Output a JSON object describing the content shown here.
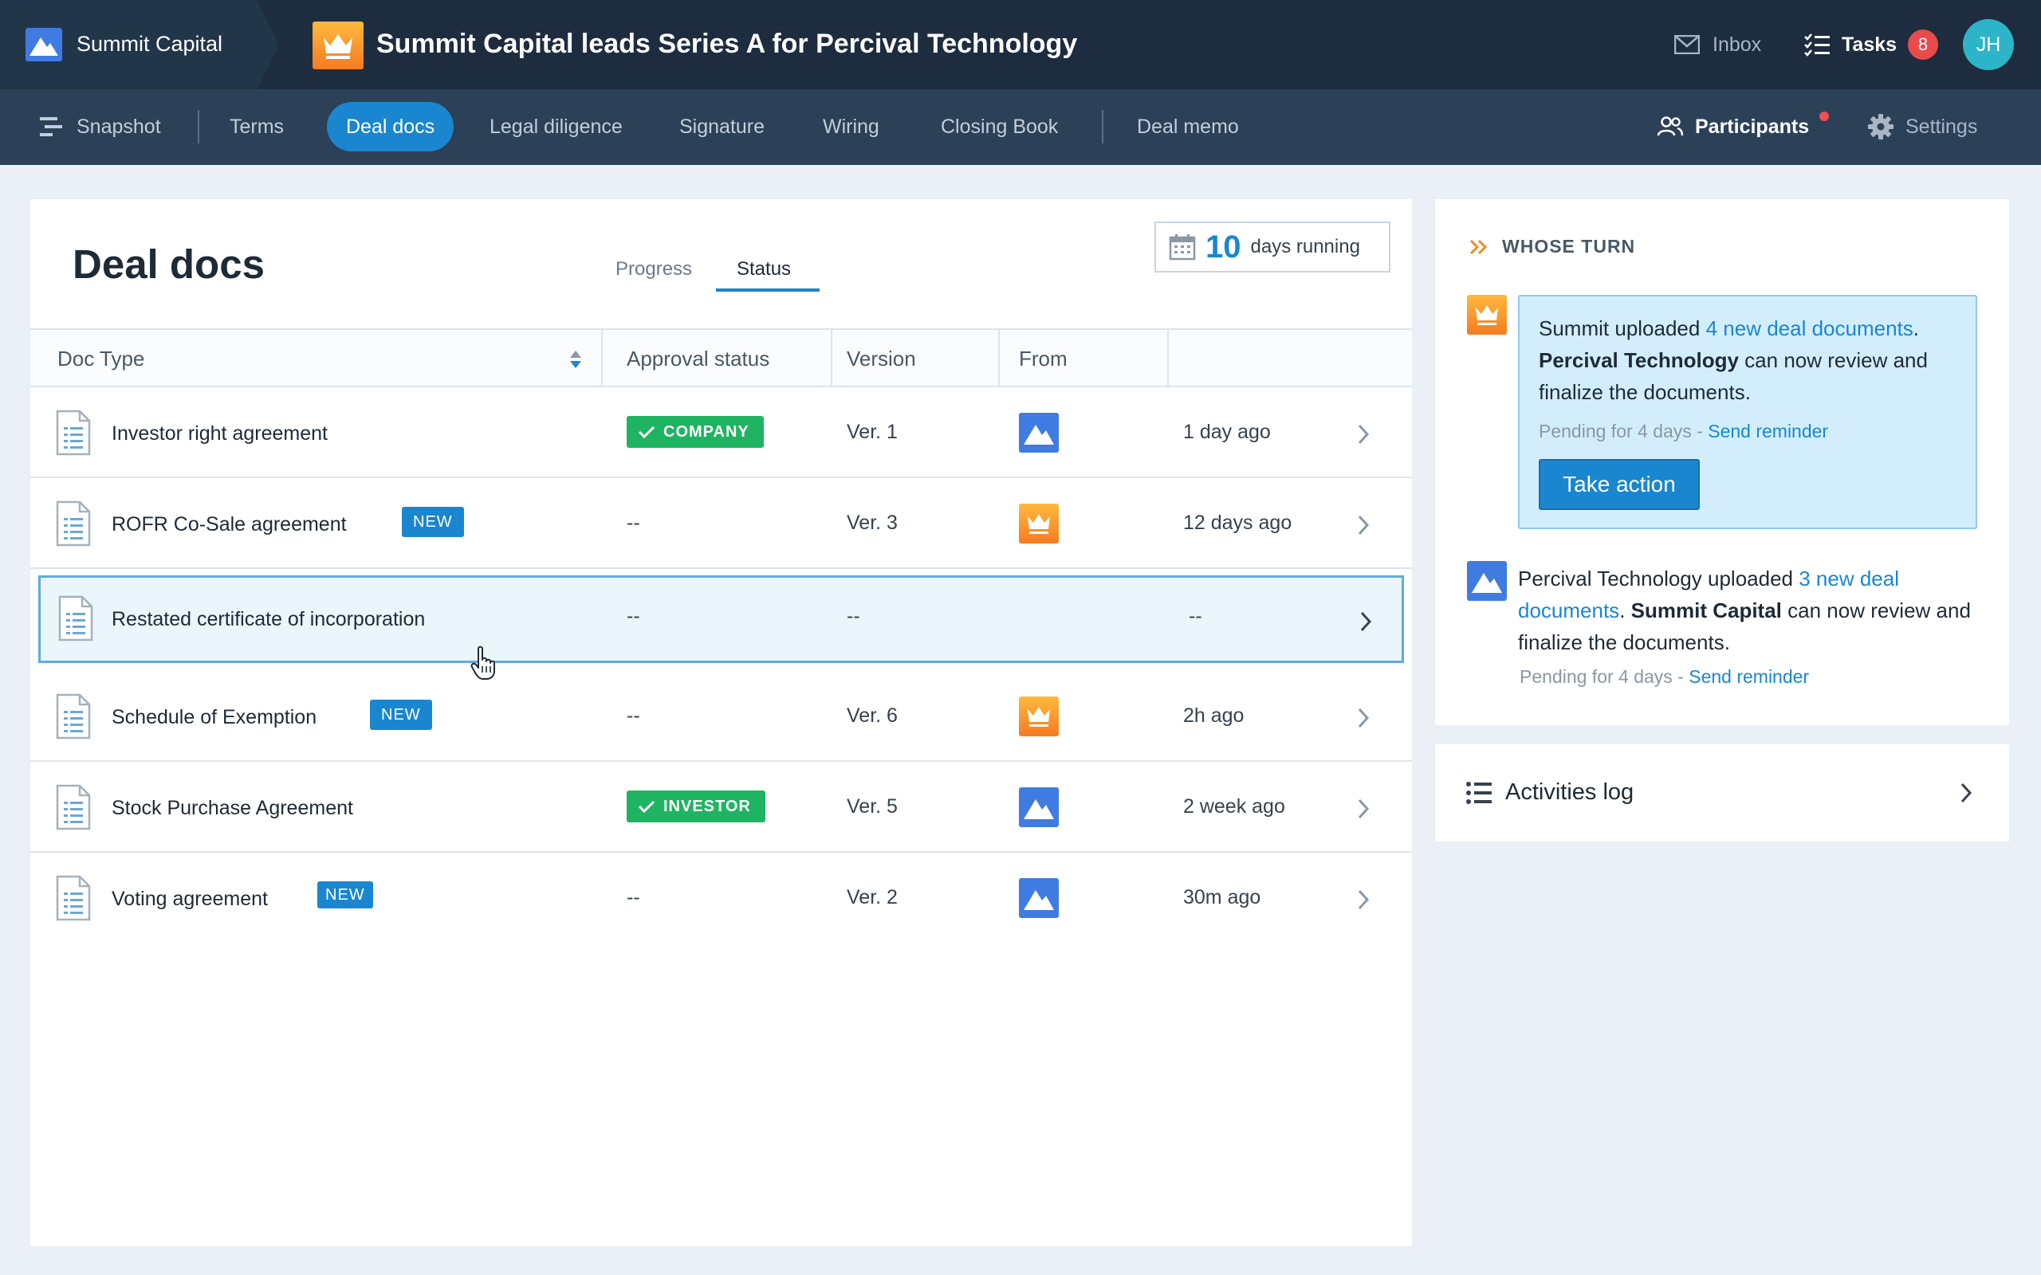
{
  "topbar": {
    "brand_name": "Summit Capital",
    "deal_title": "Summit Capital leads Series A for Percival Technology",
    "inbox_label": "Inbox",
    "tasks_label": "Tasks",
    "tasks_count": "8",
    "avatar_initials": "JH"
  },
  "nav": {
    "items": [
      {
        "label": "Snapshot",
        "icon": "snapshot-icon"
      },
      {
        "label": "Terms"
      },
      {
        "label": "Deal docs",
        "active": true
      },
      {
        "label": "Legal diligence"
      },
      {
        "label": "Signature"
      },
      {
        "label": "Wiring"
      },
      {
        "label": "Closing Book"
      },
      {
        "label": "Deal memo"
      }
    ],
    "participants_label": "Participants",
    "settings_label": "Settings"
  },
  "main": {
    "title": "Deal docs",
    "tabs": [
      {
        "label": "Progress"
      },
      {
        "label": "Status",
        "active": true
      }
    ],
    "days_count": "10",
    "days_label": "days running",
    "columns": [
      "Doc Type",
      "Approval status",
      "Version",
      "From"
    ],
    "rows": [
      {
        "name": "Investor right agreement",
        "new": false,
        "approval": "COMPANY",
        "version": "Ver. 1",
        "from": "summit-logo",
        "time": "1 day ago"
      },
      {
        "name": "ROFR Co-Sale agreement",
        "new": true,
        "new_label": "NEW",
        "approval": "--",
        "version": "Ver. 3",
        "from": "percival-logo",
        "time": "12 days ago"
      },
      {
        "name": "Restated certificate of incorporation",
        "new": false,
        "approval": "--",
        "version": "--",
        "from": "",
        "time": "--",
        "selected": true
      },
      {
        "name": "Schedule of Exemption",
        "new": true,
        "new_label": "NEW",
        "approval": "--",
        "version": "Ver. 6",
        "from": "percival-logo",
        "time": "2h ago"
      },
      {
        "name": "Stock Purchase Agreement",
        "new": false,
        "approval": "INVESTOR",
        "version": "Ver. 5",
        "from": "summit-logo",
        "time": "2 week ago"
      },
      {
        "name": "Voting agreement",
        "new": true,
        "new_label": "NEW",
        "approval": "--",
        "version": "Ver. 2",
        "from": "summit-logo",
        "time": "30m ago"
      }
    ]
  },
  "whose_turn": {
    "heading": "WHOSE TURN",
    "entries": [
      {
        "actor": "Summit",
        "verb": "uploaded",
        "link": "4 new deal documents",
        "party": "Percival Technology",
        "rest": "can now review and finalize the documents.",
        "pending": "Pending for 4 days - ",
        "reminder": "Send reminder",
        "action": "Take action"
      },
      {
        "actor": "Percival Technology",
        "verb": "uploaded",
        "link": "3 new deal documents",
        "party": "Summit Capital",
        "rest": "can now review and finalize the documents.",
        "pending": "Pending for 4 days - ",
        "reminder": "Send reminder"
      }
    ]
  },
  "activities": {
    "label": "Activities log"
  },
  "colors": {
    "topbar": "#1d2d3f",
    "navbar": "#2c4158",
    "accent": "#1a86cf",
    "success": "#1fb461",
    "alert": "#e94b4b"
  }
}
